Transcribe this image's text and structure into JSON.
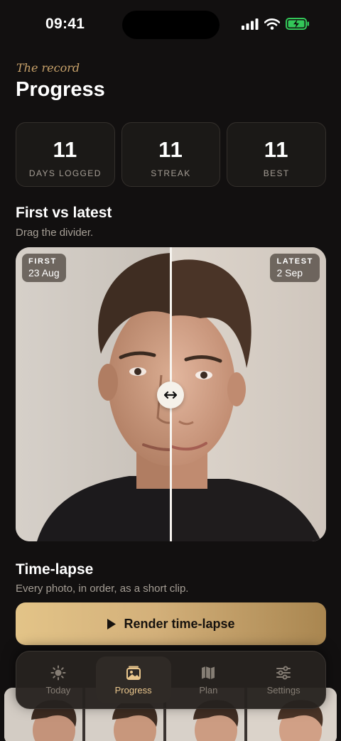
{
  "status_bar": {
    "time": "09:41"
  },
  "header": {
    "eyebrow": "The record",
    "title": "Progress"
  },
  "stats": [
    {
      "value": "11",
      "label": "DAYS LOGGED"
    },
    {
      "value": "11",
      "label": "STREAK"
    },
    {
      "value": "11",
      "label": "BEST"
    }
  ],
  "compare": {
    "title": "First vs latest",
    "subtitle": "Drag the divider.",
    "first": {
      "label": "FIRST",
      "date": "23 Aug"
    },
    "latest": {
      "label": "LATEST",
      "date": "2 Sep"
    },
    "divider_position": 0.5
  },
  "timelapse": {
    "title": "Time-lapse",
    "subtitle": "Every photo, in order, as a short clip.",
    "button_label": "Render time-lapse"
  },
  "tabs": [
    {
      "label": "Today",
      "icon": "sun-icon",
      "active": false
    },
    {
      "label": "Progress",
      "icon": "photo-stack-icon",
      "active": true
    },
    {
      "label": "Plan",
      "icon": "map-icon",
      "active": false
    },
    {
      "label": "Settings",
      "icon": "sliders-icon",
      "active": false
    }
  ],
  "colors": {
    "accent": "#e9c68d",
    "background": "#121010",
    "eyebrow": "#c9a36b"
  }
}
